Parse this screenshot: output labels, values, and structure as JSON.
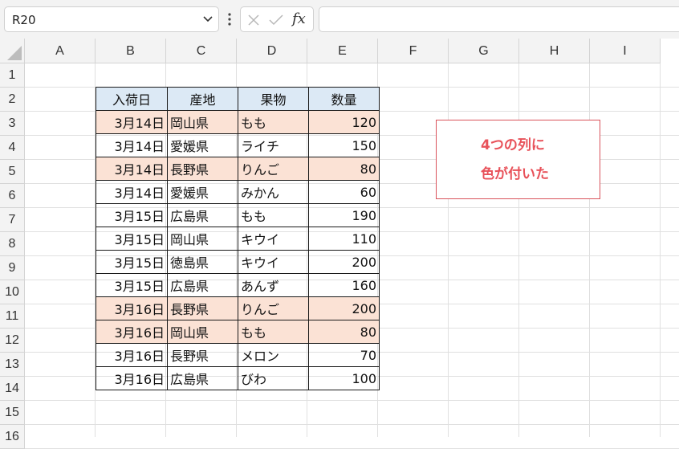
{
  "formula_bar": {
    "name_box": "R20",
    "fx_label": "fx",
    "formula": ""
  },
  "columns": [
    "A",
    "B",
    "C",
    "D",
    "E",
    "F",
    "G",
    "H",
    "I"
  ],
  "rows": [
    "1",
    "2",
    "3",
    "4",
    "5",
    "6",
    "7",
    "8",
    "9",
    "10",
    "11",
    "12",
    "13",
    "14",
    "15",
    "16"
  ],
  "table": {
    "headers": [
      "入荷日",
      "産地",
      "果物",
      "数量"
    ],
    "rows": [
      {
        "date": "3月14日",
        "origin": "岡山県",
        "fruit": "もも",
        "qty": "120",
        "highlight": true
      },
      {
        "date": "3月14日",
        "origin": "愛媛県",
        "fruit": "ライチ",
        "qty": "150",
        "highlight": false
      },
      {
        "date": "3月14日",
        "origin": "長野県",
        "fruit": "りんご",
        "qty": "80",
        "highlight": true
      },
      {
        "date": "3月14日",
        "origin": "愛媛県",
        "fruit": "みかん",
        "qty": "60",
        "highlight": false
      },
      {
        "date": "3月15日",
        "origin": "広島県",
        "fruit": "もも",
        "qty": "190",
        "highlight": false
      },
      {
        "date": "3月15日",
        "origin": "岡山県",
        "fruit": "キウイ",
        "qty": "110",
        "highlight": false
      },
      {
        "date": "3月15日",
        "origin": "徳島県",
        "fruit": "キウイ",
        "qty": "200",
        "highlight": false
      },
      {
        "date": "3月15日",
        "origin": "広島県",
        "fruit": "あんず",
        "qty": "160",
        "highlight": false
      },
      {
        "date": "3月16日",
        "origin": "長野県",
        "fruit": "りんご",
        "qty": "200",
        "highlight": true
      },
      {
        "date": "3月16日",
        "origin": "岡山県",
        "fruit": "もも",
        "qty": "80",
        "highlight": true
      },
      {
        "date": "3月16日",
        "origin": "長野県",
        "fruit": "メロン",
        "qty": "70",
        "highlight": false
      },
      {
        "date": "3月16日",
        "origin": "広島県",
        "fruit": "びわ",
        "qty": "100",
        "highlight": false
      }
    ]
  },
  "annotation": {
    "line1": "4つの列に",
    "line2": "色が付いた"
  },
  "colors": {
    "header_fill": "#dce9f5",
    "highlight_fill": "#fbe2d5",
    "annotation_text": "#e8525a",
    "annotation_border": "#d9535b"
  }
}
